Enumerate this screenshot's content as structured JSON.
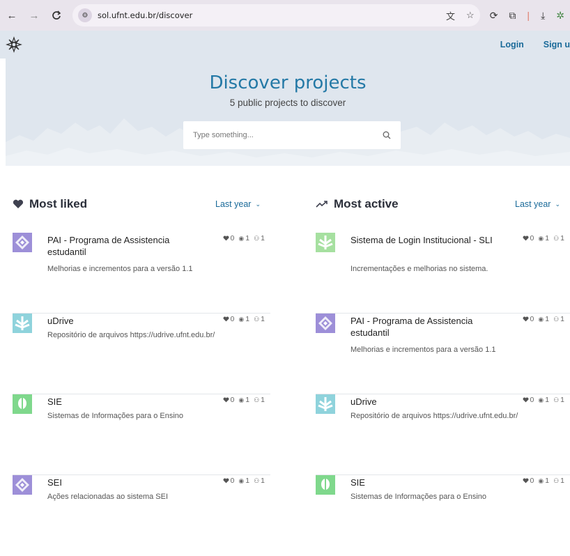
{
  "browser": {
    "url": "sol.ufnt.edu.br/discover"
  },
  "header": {
    "login": "Login",
    "signup": "Sign u"
  },
  "hero": {
    "title": "Discover projects",
    "subtitle": "5 public projects to discover",
    "search_placeholder": "Type something..."
  },
  "most_liked": {
    "title": "Most liked",
    "filter": "Last year",
    "projects": [
      {
        "name": "PAI - Programa de Assistencia estudantil",
        "desc": "Melhorias e incrementos para a versão 1.1",
        "likes": "0",
        "views": "1",
        "members": "1",
        "thumb": "purple"
      },
      {
        "name": "uDrive",
        "desc": "Repositório de arquivos https://udrive.ufnt.edu.br/",
        "likes": "0",
        "views": "1",
        "members": "1",
        "thumb": "teal"
      },
      {
        "name": "SIE",
        "desc": "Sistemas de Informações para o Ensino",
        "likes": "0",
        "views": "1",
        "members": "1",
        "thumb": "green"
      },
      {
        "name": "SEI",
        "desc": "Ações relacionadas ao sistema SEI",
        "likes": "0",
        "views": "1",
        "members": "1",
        "thumb": "purple"
      }
    ]
  },
  "most_active": {
    "title": "Most active",
    "filter": "Last year",
    "projects": [
      {
        "name": "Sistema de Login Institucional - SLI",
        "desc": "Incrementações e melhorias no sistema.",
        "likes": "0",
        "views": "1",
        "members": "1",
        "thumb": "lightgreen"
      },
      {
        "name": "PAI - Programa de Assistencia estudantil",
        "desc": "Melhorias e incrementos para a versão 1.1",
        "likes": "0",
        "views": "1",
        "members": "1",
        "thumb": "purple"
      },
      {
        "name": "uDrive",
        "desc": "Repositório de arquivos https://udrive.ufnt.edu.br/",
        "likes": "0",
        "views": "1",
        "members": "1",
        "thumb": "teal"
      },
      {
        "name": "SIE",
        "desc": "Sistemas de Informações para o Ensino",
        "likes": "0",
        "views": "1",
        "members": "1",
        "thumb": "green"
      }
    ]
  },
  "colors": {
    "accent": "#2479a6",
    "thumb_purple": "#9d8fd8",
    "thumb_teal": "#8fd3dc",
    "thumb_green": "#7fd88c",
    "thumb_lightgreen": "#a6e0a0"
  }
}
